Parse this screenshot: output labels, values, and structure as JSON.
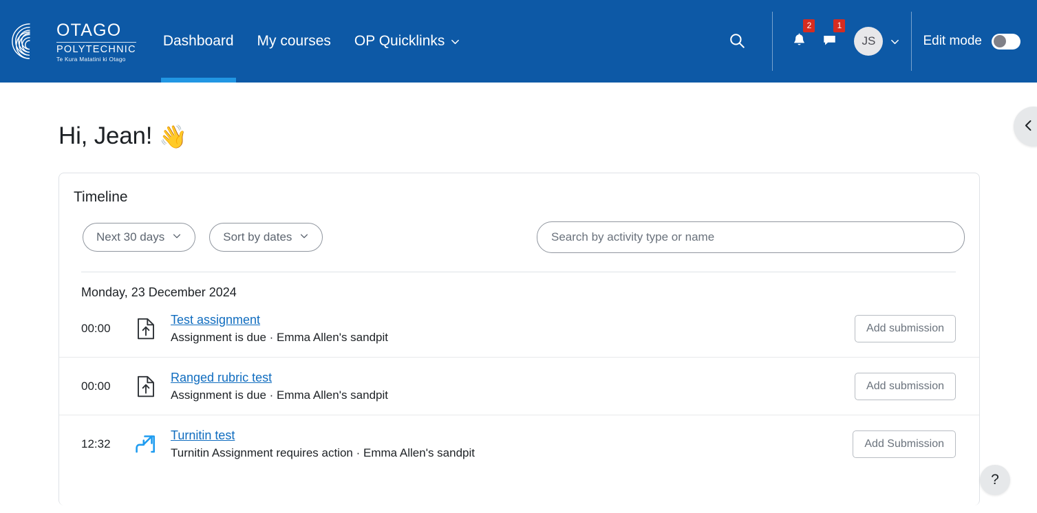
{
  "header": {
    "logo": {
      "icon": "otago-koru-spiral-logo",
      "line1": "OTAGO",
      "line2": "POLYTECHNIC",
      "line3": "Te Kura Matatini ki Otago"
    },
    "nav": [
      {
        "label": "Dashboard",
        "active": true,
        "has_caret": false
      },
      {
        "label": "My courses",
        "active": false,
        "has_caret": false
      },
      {
        "label": "OP Quicklinks",
        "active": false,
        "has_caret": true
      }
    ],
    "search_icon": "search-icon",
    "notifications": {
      "icon": "bell-icon",
      "badge": "2"
    },
    "messages": {
      "icon": "message-bubble-icon",
      "badge": "1"
    },
    "avatar": {
      "initials": "JS",
      "caret_icon": "chevron-down-icon"
    },
    "edit_mode": {
      "label": "Edit mode",
      "state": "off"
    },
    "colors": {
      "navbar_blue": "#0d59a6",
      "active_underline": "#2196e3",
      "badge_red": "#d62c20"
    }
  },
  "main": {
    "greeting": "Hi, Jean!",
    "greeting_emoji": "👋",
    "card_title": "Timeline",
    "filters": {
      "date_range": {
        "label": "Next 30 days",
        "caret_icon": "chevron-down-icon"
      },
      "sort": {
        "label": "Sort by dates",
        "caret_icon": "chevron-down-icon"
      },
      "search": {
        "value": "",
        "placeholder": "Search by activity type or name"
      }
    },
    "day_groups": [
      {
        "date_label": "Monday, 23 December 2024",
        "events": [
          {
            "time": "00:00",
            "icon": "assignment-upload-icon",
            "icon_color": "#2d3135",
            "title": "Test assignment",
            "description": "Assignment is due · Emma Allen's sandpit",
            "action_label": "Add submission"
          },
          {
            "time": "00:00",
            "icon": "assignment-upload-icon",
            "icon_color": "#2d3135",
            "title": "Ranged rubric test",
            "description": "Assignment is due · Emma Allen's sandpit",
            "action_label": "Add submission"
          },
          {
            "time": "12:32",
            "icon": "turnitin-icon",
            "icon_color": "#1f9cf0",
            "title": "Turnitin test",
            "description": "Turnitin Assignment requires action · Emma Allen's sandpit",
            "action_label": "Add Submission"
          }
        ]
      }
    ]
  },
  "floating": {
    "drawer_toggle": {
      "icon": "chevron-left-icon"
    },
    "help": {
      "icon": "question-mark-icon",
      "label": "?"
    }
  }
}
